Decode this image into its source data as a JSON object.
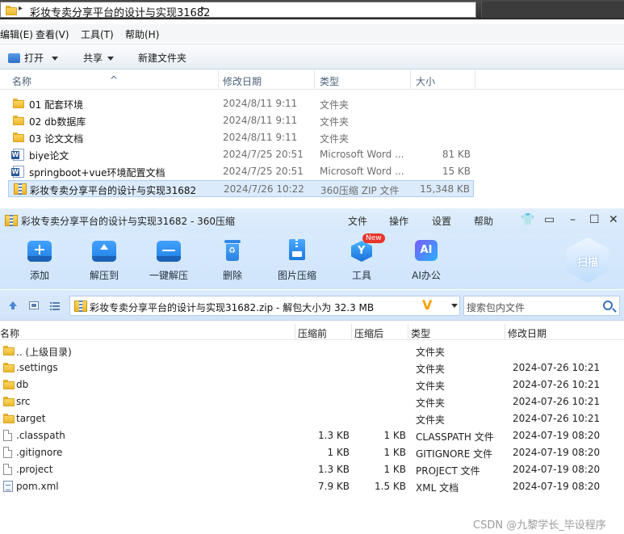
{
  "explorer": {
    "address_path": "彩妆专卖分享平台的设计与实现31682",
    "menu": [
      "编辑(E)",
      "查看(V)",
      "工具(T)",
      "帮助(H)"
    ],
    "toolbar": {
      "open": "打开",
      "share": "共享",
      "new_folder": "新建文件夹"
    },
    "columns": {
      "name": "名称",
      "date": "修改日期",
      "type": "类型",
      "size": "大小"
    },
    "rows": [
      {
        "name": "01 配套环境",
        "date": "2024/8/11 9:11",
        "type": "文件夹",
        "size": "",
        "icon": "folder-icon"
      },
      {
        "name": "02 db数据库",
        "date": "2024/8/11 9:11",
        "type": "文件夹",
        "size": "",
        "icon": "folder-icon"
      },
      {
        "name": "03 论文文档",
        "date": "2024/8/11 9:11",
        "type": "文件夹",
        "size": "",
        "icon": "folder-icon"
      },
      {
        "name": "biye论文",
        "date": "2024/7/25 20:51",
        "type": "Microsoft Word ...",
        "size": "81 KB",
        "icon": "word-doc-icon"
      },
      {
        "name": "springboot+vue环境配置文档",
        "date": "2024/7/25 20:51",
        "type": "Microsoft Word ...",
        "size": "15 KB",
        "icon": "word-doc-icon"
      },
      {
        "name": "彩妆专卖分享平台的设计与实现31682",
        "date": "2024/7/26 10:22",
        "type": "360压缩 ZIP 文件",
        "size": "15,348 KB",
        "icon": "zip-archive-icon",
        "selected": true
      }
    ]
  },
  "zipapp": {
    "title": "彩妆专卖分享平台的设计与实现31682 - 360压缩",
    "menu": [
      "文件",
      "操作",
      "设置",
      "帮助"
    ],
    "tools": [
      {
        "label": "添加",
        "icon": "add-icon"
      },
      {
        "label": "解压到",
        "icon": "extract-to-icon"
      },
      {
        "label": "一键解压",
        "icon": "one-click-extract-icon"
      },
      {
        "label": "删除",
        "icon": "delete-icon"
      },
      {
        "label": "图片压缩",
        "icon": "image-compress-icon"
      },
      {
        "label": "工具",
        "icon": "tools-icon",
        "badge": "New"
      },
      {
        "label": "AI办公",
        "icon": "ai-office-icon",
        "badge_text": "AI"
      }
    ],
    "scan_label": "扫描",
    "path": "彩妆专卖分享平台的设计与实现31682.zip - 解包大小为 32.3 MB",
    "vlogo": "V",
    "search_placeholder": "搜索包内文件",
    "columns": {
      "name": "名称",
      "before": "压缩前",
      "after": "压缩后",
      "type": "类型",
      "modified": "修改日期"
    },
    "rows": [
      {
        "name": ".. (上级目录)",
        "before": "",
        "after": "",
        "type": "文件夹",
        "modified": "",
        "icon": "folder-icon"
      },
      {
        "name": ".settings",
        "before": "",
        "after": "",
        "type": "文件夹",
        "modified": "2024-07-26 10:21",
        "icon": "folder-icon"
      },
      {
        "name": "db",
        "before": "",
        "after": "",
        "type": "文件夹",
        "modified": "2024-07-26 10:21",
        "icon": "folder-icon"
      },
      {
        "name": "src",
        "before": "",
        "after": "",
        "type": "文件夹",
        "modified": "2024-07-26 10:21",
        "icon": "folder-icon"
      },
      {
        "name": "target",
        "before": "",
        "after": "",
        "type": "文件夹",
        "modified": "2024-07-26 10:21",
        "icon": "folder-icon"
      },
      {
        "name": ".classpath",
        "before": "1.3 KB",
        "after": "1 KB",
        "type": "CLASSPATH 文件",
        "modified": "2024-07-19 08:20",
        "icon": "file-icon"
      },
      {
        "name": ".gitignore",
        "before": "1 KB",
        "after": "1 KB",
        "type": "GITIGNORE 文件",
        "modified": "2024-07-19 08:20",
        "icon": "file-icon"
      },
      {
        "name": ".project",
        "before": "1.3 KB",
        "after": "1 KB",
        "type": "PROJECT 文件",
        "modified": "2024-07-19 08:20",
        "icon": "file-icon"
      },
      {
        "name": "pom.xml",
        "before": "7.9 KB",
        "after": "1.5 KB",
        "type": "XML 文档",
        "modified": "2024-07-19 08:20",
        "icon": "xml-file-icon"
      }
    ]
  },
  "watermark": "CSDN @九黎学长_毕设程序"
}
